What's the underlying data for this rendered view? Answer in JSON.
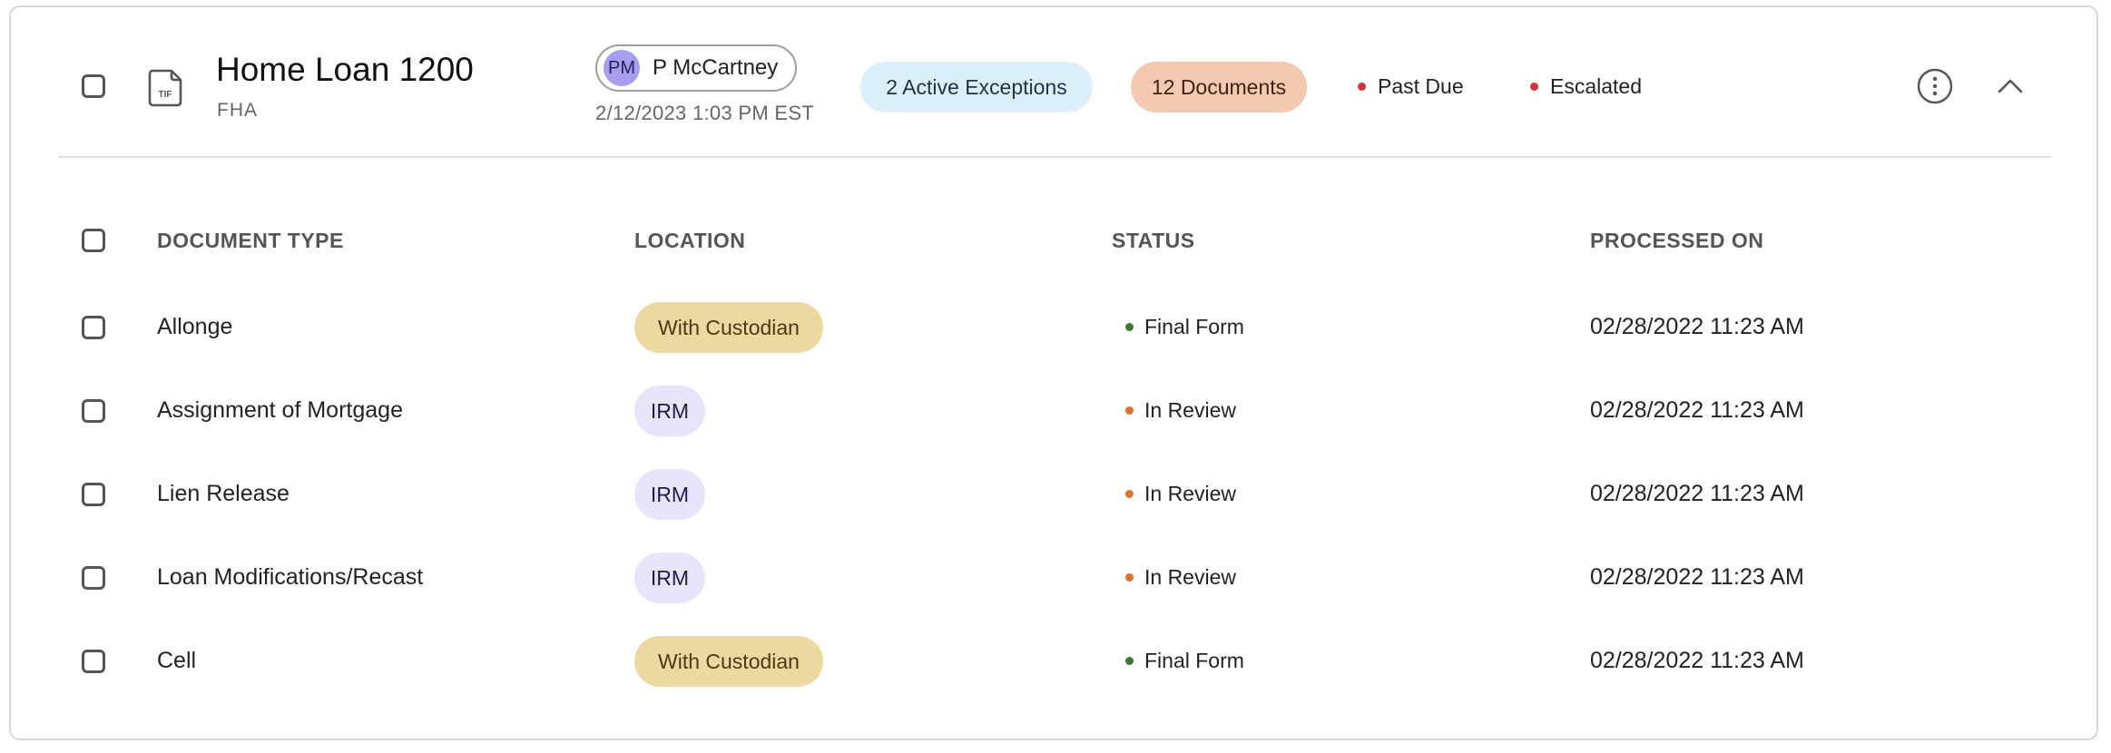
{
  "loan": {
    "title": "Home Loan 1200",
    "type": "FHA",
    "file_icon_label": "TIF"
  },
  "assignee": {
    "initials": "PM",
    "name": "P McCartney",
    "timestamp": "2/12/2023 1:03 PM EST"
  },
  "badges": {
    "exceptions": "2 Active Exceptions",
    "documents": "12 Documents"
  },
  "flags": [
    {
      "label": "Past Due",
      "color": "#d0343a"
    },
    {
      "label": "Escalated",
      "color": "#d0343a"
    }
  ],
  "table": {
    "headers": {
      "document_type": "DOCUMENT TYPE",
      "location": "LOCATION",
      "status": "STATUS",
      "processed_on": "PROCESSED ON"
    },
    "rows": [
      {
        "document_type": "Allonge",
        "location": "With Custodian",
        "location_kind": "custodian",
        "status": "Final Form",
        "status_color": "#3b7a34",
        "processed_on": "02/28/2022 11:23 AM"
      },
      {
        "document_type": "Assignment of Mortgage",
        "location": "IRM",
        "location_kind": "irm",
        "status": "In Review",
        "status_color": "#e0702e",
        "processed_on": "02/28/2022 11:23 AM"
      },
      {
        "document_type": "Lien Release",
        "location": "IRM",
        "location_kind": "irm",
        "status": "In Review",
        "status_color": "#e0702e",
        "processed_on": "02/28/2022 11:23 AM"
      },
      {
        "document_type": "Loan Modifications/Recast",
        "location": "IRM",
        "location_kind": "irm",
        "status": "In Review",
        "status_color": "#e0702e",
        "processed_on": "02/28/2022 11:23 AM"
      },
      {
        "document_type": "Cell",
        "location": "With Custodian",
        "location_kind": "custodian",
        "status": "Final Form",
        "status_color": "#3b7a34",
        "processed_on": "02/28/2022 11:23 AM"
      }
    ]
  },
  "icons": {
    "file": "file-icon",
    "more": "more-vertical-icon",
    "collapse": "chevron-up-icon"
  }
}
